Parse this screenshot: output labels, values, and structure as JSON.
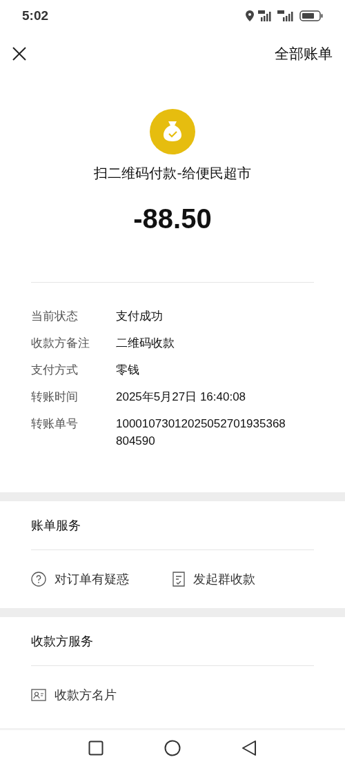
{
  "status_bar": {
    "time": "5:02"
  },
  "nav": {
    "action": "全部账单"
  },
  "summary": {
    "title": "扫二维码付款-给便民超市",
    "amount": "-88.50"
  },
  "details": [
    {
      "label": "当前状态",
      "value": "支付成功"
    },
    {
      "label": "收款方备注",
      "value": "二维码收款"
    },
    {
      "label": "支付方式",
      "value": "零钱"
    },
    {
      "label": "转账时间",
      "value": "2025年5月27日 16:40:08"
    },
    {
      "label": "转账单号",
      "value": "10001073012025052701935368804590"
    }
  ],
  "sections": [
    {
      "title": "账单服务",
      "items": [
        {
          "kind": "question",
          "label": "对订单有疑惑"
        },
        {
          "kind": "receipt",
          "label": "发起群收款"
        }
      ]
    },
    {
      "title": "收款方服务",
      "items": [
        {
          "kind": "card",
          "label": "收款方名片"
        }
      ]
    }
  ]
}
